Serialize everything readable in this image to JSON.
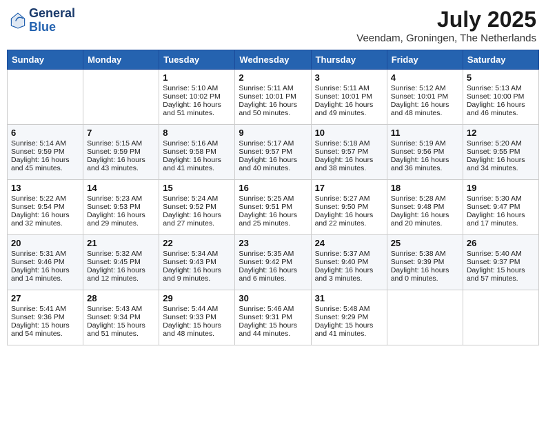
{
  "header": {
    "logo_general": "General",
    "logo_blue": "Blue",
    "month_title": "July 2025",
    "location": "Veendam, Groningen, The Netherlands"
  },
  "weekdays": [
    "Sunday",
    "Monday",
    "Tuesday",
    "Wednesday",
    "Thursday",
    "Friday",
    "Saturday"
  ],
  "weeks": [
    [
      {
        "day": "",
        "sunrise": "",
        "sunset": "",
        "daylight": ""
      },
      {
        "day": "",
        "sunrise": "",
        "sunset": "",
        "daylight": ""
      },
      {
        "day": "1",
        "sunrise": "Sunrise: 5:10 AM",
        "sunset": "Sunset: 10:02 PM",
        "daylight": "Daylight: 16 hours and 51 minutes."
      },
      {
        "day": "2",
        "sunrise": "Sunrise: 5:11 AM",
        "sunset": "Sunset: 10:01 PM",
        "daylight": "Daylight: 16 hours and 50 minutes."
      },
      {
        "day": "3",
        "sunrise": "Sunrise: 5:11 AM",
        "sunset": "Sunset: 10:01 PM",
        "daylight": "Daylight: 16 hours and 49 minutes."
      },
      {
        "day": "4",
        "sunrise": "Sunrise: 5:12 AM",
        "sunset": "Sunset: 10:01 PM",
        "daylight": "Daylight: 16 hours and 48 minutes."
      },
      {
        "day": "5",
        "sunrise": "Sunrise: 5:13 AM",
        "sunset": "Sunset: 10:00 PM",
        "daylight": "Daylight: 16 hours and 46 minutes."
      }
    ],
    [
      {
        "day": "6",
        "sunrise": "Sunrise: 5:14 AM",
        "sunset": "Sunset: 9:59 PM",
        "daylight": "Daylight: 16 hours and 45 minutes."
      },
      {
        "day": "7",
        "sunrise": "Sunrise: 5:15 AM",
        "sunset": "Sunset: 9:59 PM",
        "daylight": "Daylight: 16 hours and 43 minutes."
      },
      {
        "day": "8",
        "sunrise": "Sunrise: 5:16 AM",
        "sunset": "Sunset: 9:58 PM",
        "daylight": "Daylight: 16 hours and 41 minutes."
      },
      {
        "day": "9",
        "sunrise": "Sunrise: 5:17 AM",
        "sunset": "Sunset: 9:57 PM",
        "daylight": "Daylight: 16 hours and 40 minutes."
      },
      {
        "day": "10",
        "sunrise": "Sunrise: 5:18 AM",
        "sunset": "Sunset: 9:57 PM",
        "daylight": "Daylight: 16 hours and 38 minutes."
      },
      {
        "day": "11",
        "sunrise": "Sunrise: 5:19 AM",
        "sunset": "Sunset: 9:56 PM",
        "daylight": "Daylight: 16 hours and 36 minutes."
      },
      {
        "day": "12",
        "sunrise": "Sunrise: 5:20 AM",
        "sunset": "Sunset: 9:55 PM",
        "daylight": "Daylight: 16 hours and 34 minutes."
      }
    ],
    [
      {
        "day": "13",
        "sunrise": "Sunrise: 5:22 AM",
        "sunset": "Sunset: 9:54 PM",
        "daylight": "Daylight: 16 hours and 32 minutes."
      },
      {
        "day": "14",
        "sunrise": "Sunrise: 5:23 AM",
        "sunset": "Sunset: 9:53 PM",
        "daylight": "Daylight: 16 hours and 29 minutes."
      },
      {
        "day": "15",
        "sunrise": "Sunrise: 5:24 AM",
        "sunset": "Sunset: 9:52 PM",
        "daylight": "Daylight: 16 hours and 27 minutes."
      },
      {
        "day": "16",
        "sunrise": "Sunrise: 5:25 AM",
        "sunset": "Sunset: 9:51 PM",
        "daylight": "Daylight: 16 hours and 25 minutes."
      },
      {
        "day": "17",
        "sunrise": "Sunrise: 5:27 AM",
        "sunset": "Sunset: 9:50 PM",
        "daylight": "Daylight: 16 hours and 22 minutes."
      },
      {
        "day": "18",
        "sunrise": "Sunrise: 5:28 AM",
        "sunset": "Sunset: 9:48 PM",
        "daylight": "Daylight: 16 hours and 20 minutes."
      },
      {
        "day": "19",
        "sunrise": "Sunrise: 5:30 AM",
        "sunset": "Sunset: 9:47 PM",
        "daylight": "Daylight: 16 hours and 17 minutes."
      }
    ],
    [
      {
        "day": "20",
        "sunrise": "Sunrise: 5:31 AM",
        "sunset": "Sunset: 9:46 PM",
        "daylight": "Daylight: 16 hours and 14 minutes."
      },
      {
        "day": "21",
        "sunrise": "Sunrise: 5:32 AM",
        "sunset": "Sunset: 9:45 PM",
        "daylight": "Daylight: 16 hours and 12 minutes."
      },
      {
        "day": "22",
        "sunrise": "Sunrise: 5:34 AM",
        "sunset": "Sunset: 9:43 PM",
        "daylight": "Daylight: 16 hours and 9 minutes."
      },
      {
        "day": "23",
        "sunrise": "Sunrise: 5:35 AM",
        "sunset": "Sunset: 9:42 PM",
        "daylight": "Daylight: 16 hours and 6 minutes."
      },
      {
        "day": "24",
        "sunrise": "Sunrise: 5:37 AM",
        "sunset": "Sunset: 9:40 PM",
        "daylight": "Daylight: 16 hours and 3 minutes."
      },
      {
        "day": "25",
        "sunrise": "Sunrise: 5:38 AM",
        "sunset": "Sunset: 9:39 PM",
        "daylight": "Daylight: 16 hours and 0 minutes."
      },
      {
        "day": "26",
        "sunrise": "Sunrise: 5:40 AM",
        "sunset": "Sunset: 9:37 PM",
        "daylight": "Daylight: 15 hours and 57 minutes."
      }
    ],
    [
      {
        "day": "27",
        "sunrise": "Sunrise: 5:41 AM",
        "sunset": "Sunset: 9:36 PM",
        "daylight": "Daylight: 15 hours and 54 minutes."
      },
      {
        "day": "28",
        "sunrise": "Sunrise: 5:43 AM",
        "sunset": "Sunset: 9:34 PM",
        "daylight": "Daylight: 15 hours and 51 minutes."
      },
      {
        "day": "29",
        "sunrise": "Sunrise: 5:44 AM",
        "sunset": "Sunset: 9:33 PM",
        "daylight": "Daylight: 15 hours and 48 minutes."
      },
      {
        "day": "30",
        "sunrise": "Sunrise: 5:46 AM",
        "sunset": "Sunset: 9:31 PM",
        "daylight": "Daylight: 15 hours and 44 minutes."
      },
      {
        "day": "31",
        "sunrise": "Sunrise: 5:48 AM",
        "sunset": "Sunset: 9:29 PM",
        "daylight": "Daylight: 15 hours and 41 minutes."
      },
      {
        "day": "",
        "sunrise": "",
        "sunset": "",
        "daylight": ""
      },
      {
        "day": "",
        "sunrise": "",
        "sunset": "",
        "daylight": ""
      }
    ]
  ]
}
